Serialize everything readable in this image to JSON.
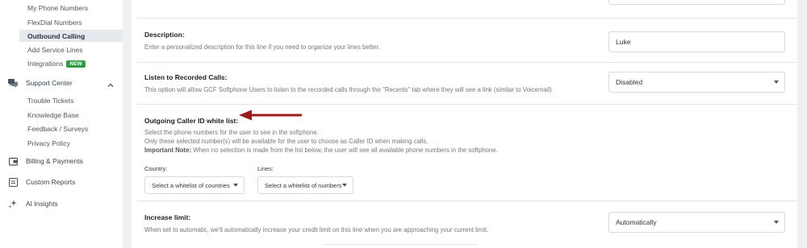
{
  "sidebar": {
    "phone_items": [
      {
        "label": "My Phone Numbers"
      },
      {
        "label": "FlexDial Numbers"
      },
      {
        "label": "Outbound Calling"
      },
      {
        "label": "Add Service Lines"
      },
      {
        "label": "Integrations",
        "badge": "NEW"
      }
    ],
    "support_center": {
      "label": "Support Center",
      "icon": "chat-bubbles-icon",
      "items": [
        {
          "label": "Trouble Tickets"
        },
        {
          "label": "Knowledge Base"
        },
        {
          "label": "Feedback / Surveys"
        },
        {
          "label": "Privacy Policy"
        }
      ]
    },
    "billing": {
      "label": "Billing & Payments",
      "icon": "wallet-icon"
    },
    "reports": {
      "label": "Custom Reports",
      "icon": "report-icon"
    },
    "ai": {
      "label": "AI Insights",
      "icon": "sparkle-icon"
    }
  },
  "settings": {
    "description": {
      "label": "Description:",
      "help": "Enter a personalized description for this line if you need to organize your lines better.",
      "value": "Luke"
    },
    "recorded_calls": {
      "label": "Listen to Recorded Calls:",
      "help": "This option will allow GCF Softphone Users to listen to the recorded calls through the \"Recents\" tab where they will see a link (similar to Voicemail)",
      "value": "Disabled"
    },
    "caller_id": {
      "label": "Outgoing Caller ID white list:",
      "help_line1": "Select the phone numbers for the user to see in the softphone.",
      "help_line2": "Only these selected number(s) will be available for the user to choose as Caller ID when making calls.",
      "note_label": "Important Note:",
      "note_text": "When no selection is made from the list below, the user will see all available phone numbers in the softphone.",
      "country_label": "Country:",
      "country_placeholder": "Select a whitelist of countries",
      "lines_label": "Lines:",
      "lines_placeholder": "Select a whitelist of numbers"
    },
    "increase_limit": {
      "label": "Increase limit:",
      "help": "When set to automatic, we'll automatically increase your credit limit on this line when you are approaching your current limit.",
      "value": "Automatically"
    }
  },
  "colors": {
    "badge": "#2e9b47",
    "arrow": "#9b1c1c",
    "active_item_bg": "#e6e9ee"
  }
}
